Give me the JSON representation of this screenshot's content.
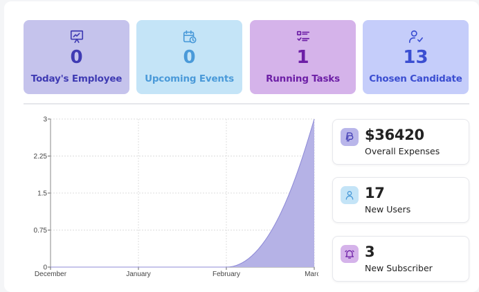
{
  "cards": [
    {
      "value": "0",
      "label": "Today's Employee",
      "icon": "presentation-chart-icon",
      "bg": "#c5c3ec",
      "color": "#3f3bb3"
    },
    {
      "value": "0",
      "label": "Upcoming Events",
      "icon": "calendar-clock-icon",
      "bg": "#c4e4f7",
      "color": "#4a9ad9"
    },
    {
      "value": "1",
      "label": "Running Tasks",
      "icon": "task-list-icon",
      "bg": "#d5b3ea",
      "color": "#6d1fa6"
    },
    {
      "value": "13",
      "label": "Chosen Candidate",
      "icon": "user-check-icon",
      "bg": "#c5cdfa",
      "color": "#3b4ed1"
    }
  ],
  "stats": [
    {
      "value": "$36420",
      "label": "Overall Expenses",
      "icon": "paypal-icon",
      "bg": "#b9b6ea",
      "color": "#3f3bb3"
    },
    {
      "value": "17",
      "label": "New Users",
      "icon": "user-icon",
      "bg": "#c4e4f7",
      "color": "#4a9ad9"
    },
    {
      "value": "3",
      "label": "New Subscriber",
      "icon": "bell-ring-icon",
      "bg": "#d5b3ea",
      "color": "#6d1fa6"
    }
  ],
  "chart_data": {
    "type": "area",
    "categories": [
      "December",
      "January",
      "February",
      "March"
    ],
    "series": [
      {
        "values": [
          0,
          0,
          0,
          3
        ]
      }
    ],
    "yticks": [
      "0",
      "0.75",
      "1.5",
      "2.25",
      "3"
    ],
    "ylim": [
      0,
      3
    ],
    "grid": true,
    "fill": "#b5b2e6",
    "stroke": "#8c88d6"
  }
}
